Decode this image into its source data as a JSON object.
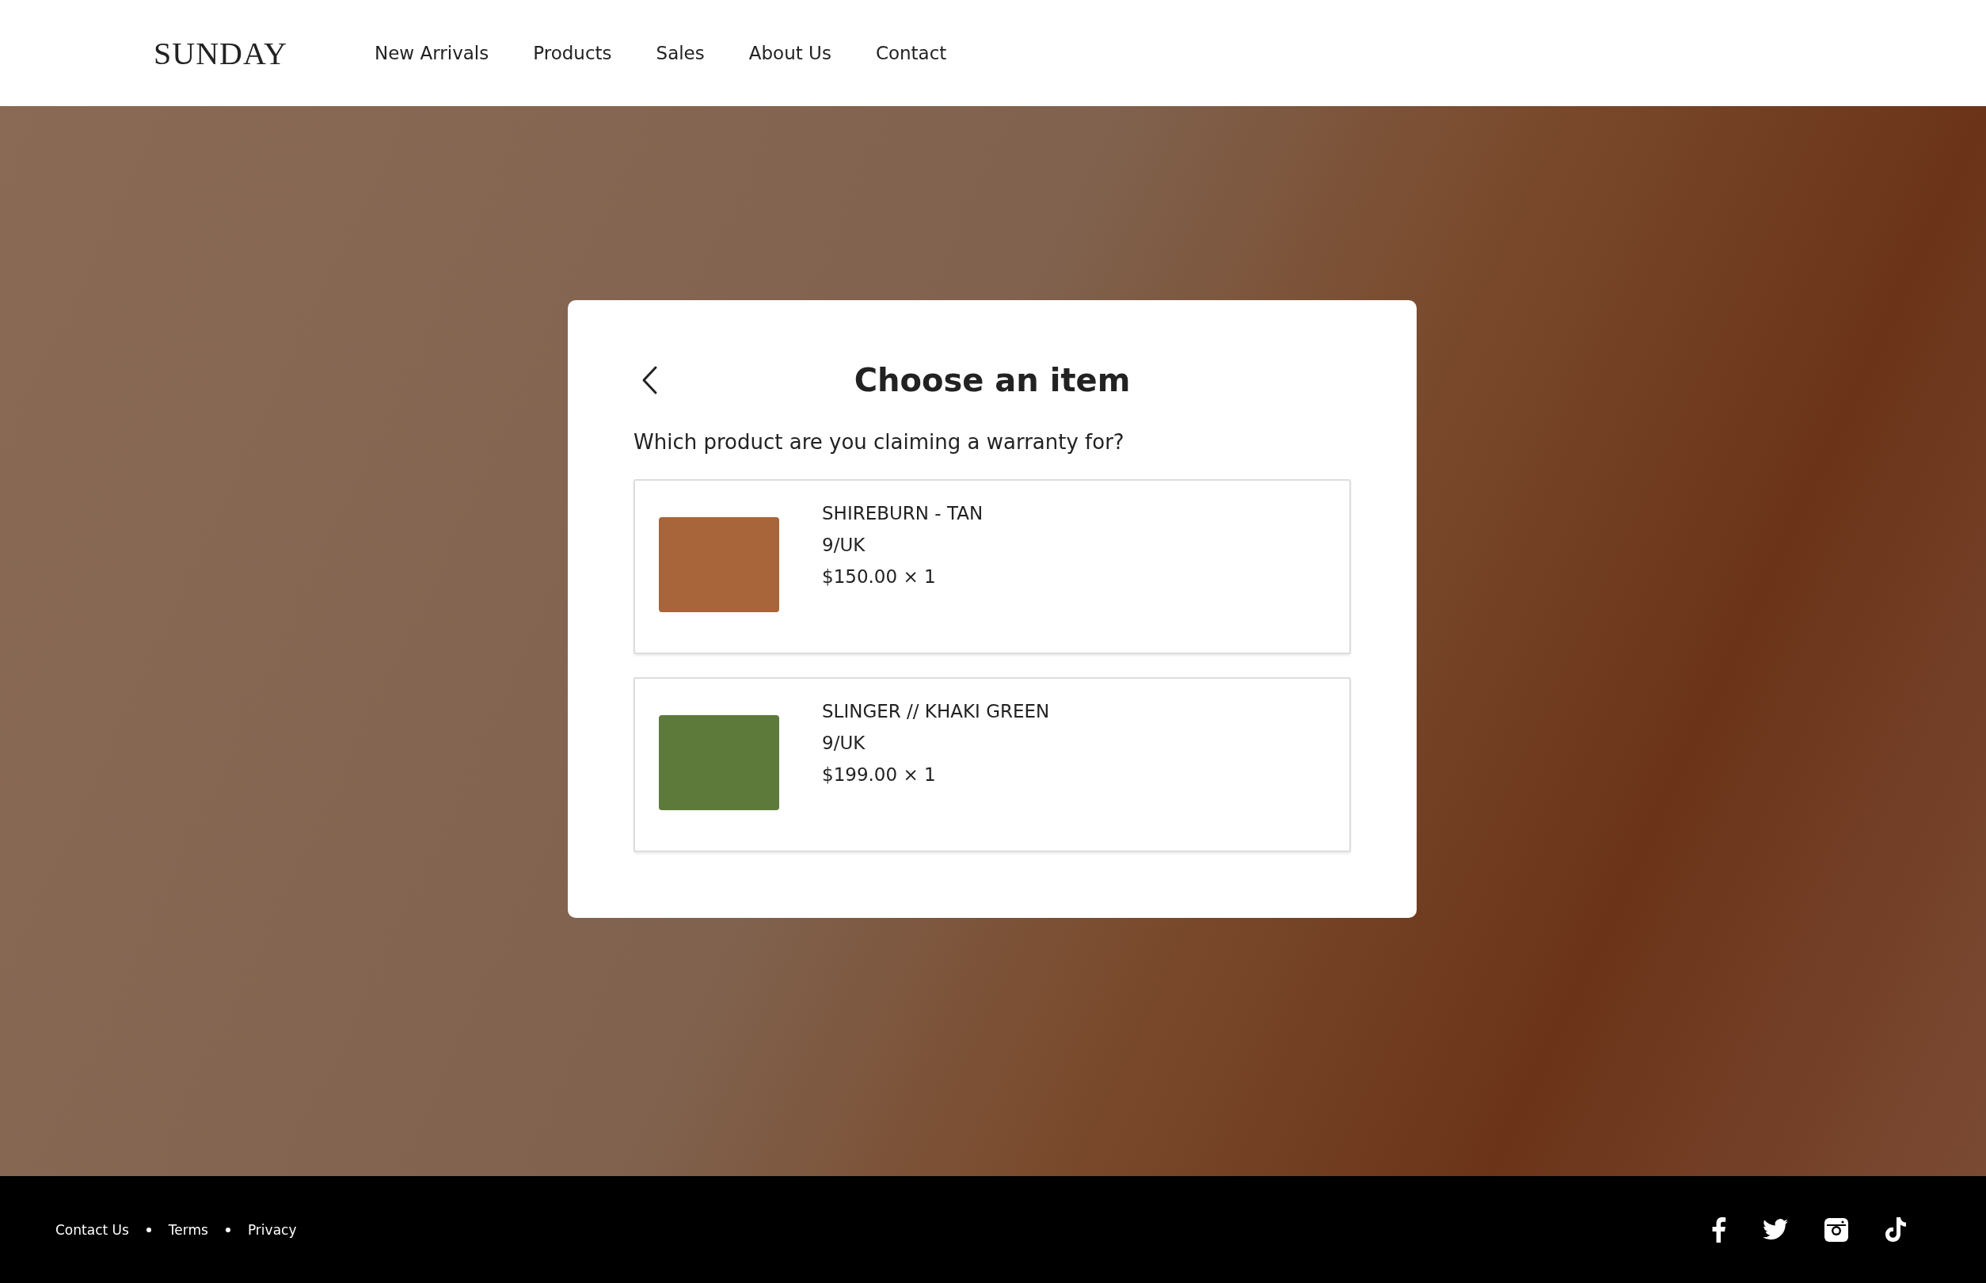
{
  "header": {
    "logo": "SUNDAY",
    "nav": [
      {
        "label": "New Arrivals"
      },
      {
        "label": "Products"
      },
      {
        "label": "Sales"
      },
      {
        "label": "About Us"
      },
      {
        "label": "Contact"
      }
    ]
  },
  "dialog": {
    "title": "Choose an item",
    "question": "Which product are you claiming a warranty for?",
    "items": [
      {
        "name": "SHIREBURN - TAN",
        "size": "9/UK",
        "price": "$150.00 × 1"
      },
      {
        "name": "SLINGER // KHAKI GREEN",
        "size": "9/UK",
        "price": "$199.00 × 1"
      }
    ]
  },
  "footer": {
    "links": [
      {
        "label": "Contact Us"
      },
      {
        "label": "Terms"
      },
      {
        "label": "Privacy"
      }
    ],
    "social": [
      {
        "kind": "facebook"
      },
      {
        "kind": "twitter"
      },
      {
        "kind": "instagram"
      },
      {
        "kind": "tiktok"
      }
    ]
  }
}
